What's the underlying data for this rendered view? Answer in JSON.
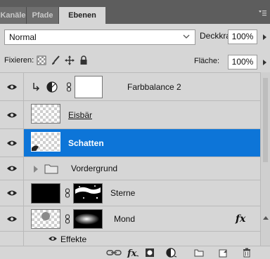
{
  "tabs": [
    {
      "label": "Kanäle"
    },
    {
      "label": "Pfade"
    },
    {
      "label": "Ebenen"
    }
  ],
  "blend_mode": {
    "value": "Normal"
  },
  "opacity": {
    "label": "Deckkraft:",
    "value": "100%"
  },
  "lock": {
    "label": "Fixieren:"
  },
  "fill": {
    "label": "Fläche:",
    "value": "100%"
  },
  "layers": [
    {
      "name": "Farbbalance 2",
      "kind": "adjustment",
      "clipped": true
    },
    {
      "name": "Eisbär",
      "kind": "pixel"
    },
    {
      "name": "Schatten",
      "kind": "pixel",
      "selected": true
    },
    {
      "name": "Vordergrund",
      "kind": "group"
    },
    {
      "name": "Sterne",
      "kind": "masked"
    },
    {
      "name": "Mond",
      "kind": "masked",
      "fx": "fx",
      "effects_label": "Effekte"
    }
  ],
  "colors": {
    "accent": "#0d75d8",
    "panel": "#d6d6d6",
    "tabbar": "#5d5d5d"
  }
}
